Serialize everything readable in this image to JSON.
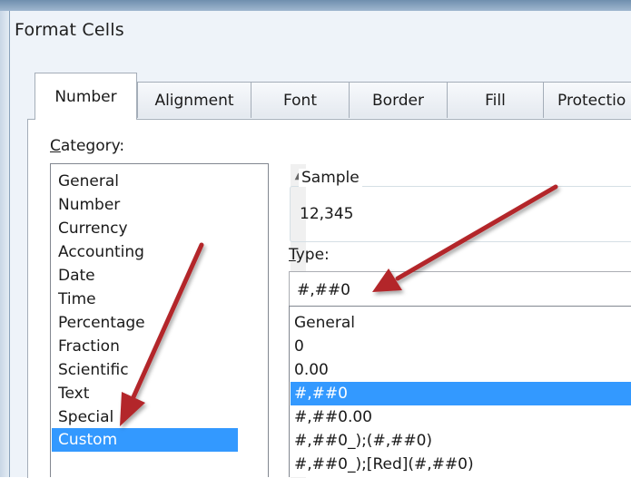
{
  "window": {
    "title": "Format Cells"
  },
  "tabs": [
    {
      "label": "Number"
    },
    {
      "label": "Alignment"
    },
    {
      "label": "Font"
    },
    {
      "label": "Border"
    },
    {
      "label": "Fill"
    },
    {
      "label": "Protectio"
    }
  ],
  "category": {
    "label_underlined": "C",
    "label_rest": "ategory:",
    "items": [
      "General",
      "Number",
      "Currency",
      "Accounting",
      "Date",
      "Time",
      "Percentage",
      "Fraction",
      "Scientific",
      "Text",
      "Special",
      "Custom"
    ],
    "selected": "Custom"
  },
  "sample": {
    "legend": "Sample",
    "value": "12,345"
  },
  "type": {
    "label_underlined": "T",
    "label_rest": "ype:",
    "value": "#,##0",
    "items": [
      "General",
      "0",
      "0.00",
      "#,##0",
      "#,##0.00",
      "#,##0_);(#,##0)",
      "#,##0_);[Red](#,##0)"
    ],
    "selected": "#,##0"
  },
  "colors": {
    "selection": "#3399ff",
    "arrow": "#b3262a"
  }
}
